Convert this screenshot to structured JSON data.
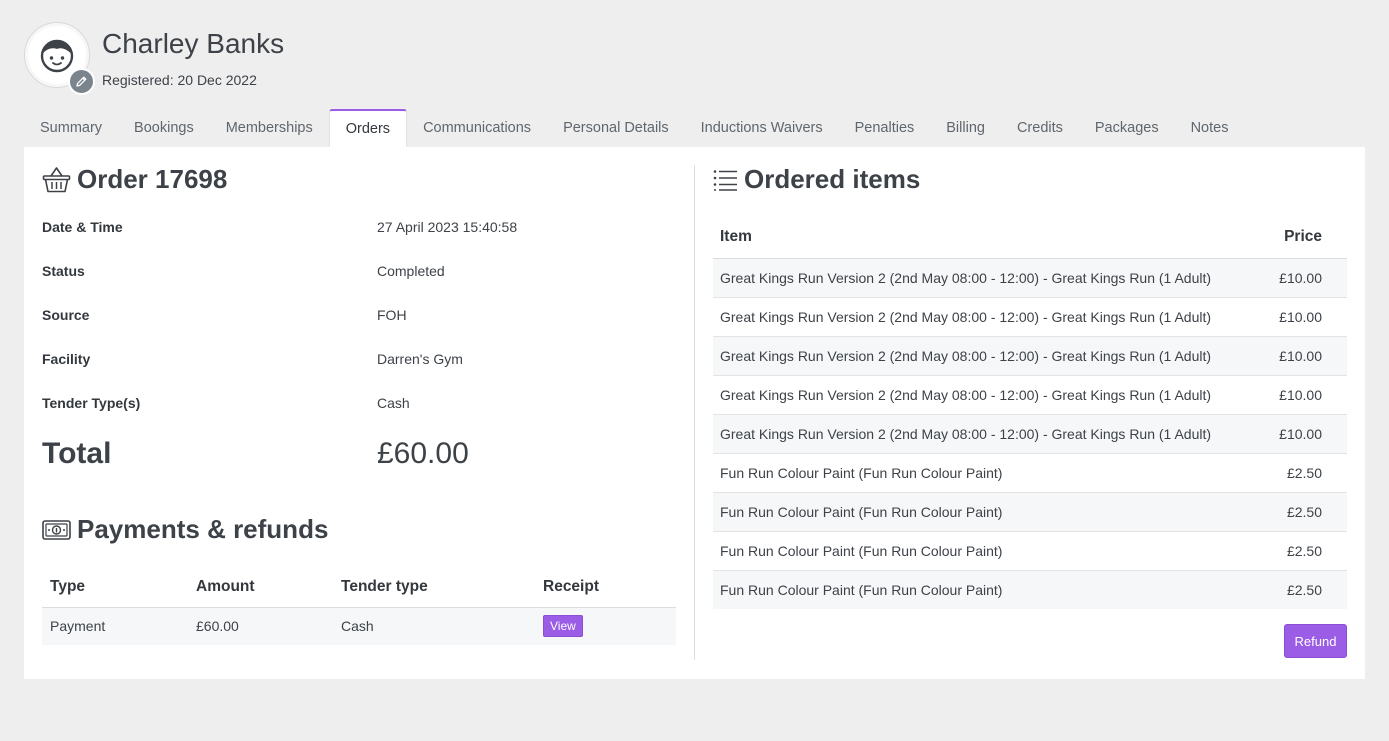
{
  "member": {
    "name": "Charley Banks",
    "registered": "Registered: 20 Dec 2022"
  },
  "tabs": [
    {
      "label": "Summary"
    },
    {
      "label": "Bookings"
    },
    {
      "label": "Memberships"
    },
    {
      "label": "Orders",
      "active": true
    },
    {
      "label": "Communications"
    },
    {
      "label": "Personal Details"
    },
    {
      "label": "Inductions Waivers"
    },
    {
      "label": "Penalties"
    },
    {
      "label": "Billing"
    },
    {
      "label": "Credits"
    },
    {
      "label": "Packages"
    },
    {
      "label": "Notes"
    }
  ],
  "order": {
    "title": "Order 17698",
    "icon": "basket-icon",
    "details": [
      {
        "label": "Date & Time",
        "value": "27 April 2023 15:40:58"
      },
      {
        "label": "Status",
        "value": "Completed"
      },
      {
        "label": "Source",
        "value": "FOH"
      },
      {
        "label": "Facility",
        "value": "Darren's Gym"
      },
      {
        "label": "Tender Type(s)",
        "value": "Cash"
      }
    ],
    "total_label": "Total",
    "total_value": "£60.00"
  },
  "payments": {
    "title": "Payments & refunds",
    "icon": "money-icon",
    "columns": [
      "Type",
      "Amount",
      "Tender type",
      "Receipt"
    ],
    "rows": [
      {
        "type": "Payment",
        "amount": "£60.00",
        "tender": "Cash",
        "receipt": "View"
      }
    ]
  },
  "items": {
    "title": "Ordered items",
    "icon": "list-icon",
    "columns": [
      "Item",
      "Price"
    ],
    "rows": [
      {
        "item": "Great Kings Run Version 2 (2nd May 08:00 - 12:00) - Great Kings Run (1 Adult)",
        "price": "£10.00"
      },
      {
        "item": "Great Kings Run Version 2 (2nd May 08:00 - 12:00) - Great Kings Run (1 Adult)",
        "price": "£10.00"
      },
      {
        "item": "Great Kings Run Version 2 (2nd May 08:00 - 12:00) - Great Kings Run (1 Adult)",
        "price": "£10.00"
      },
      {
        "item": "Great Kings Run Version 2 (2nd May 08:00 - 12:00) - Great Kings Run (1 Adult)",
        "price": "£10.00"
      },
      {
        "item": "Great Kings Run Version 2 (2nd May 08:00 - 12:00) - Great Kings Run (1 Adult)",
        "price": "£10.00"
      },
      {
        "item": "Fun Run Colour Paint (Fun Run Colour Paint)",
        "price": "£2.50"
      },
      {
        "item": "Fun Run Colour Paint (Fun Run Colour Paint)",
        "price": "£2.50"
      },
      {
        "item": "Fun Run Colour Paint (Fun Run Colour Paint)",
        "price": "£2.50"
      },
      {
        "item": "Fun Run Colour Paint (Fun Run Colour Paint)",
        "price": "£2.50"
      }
    ],
    "refund_label": "Refund"
  },
  "colors": {
    "accent": "#9b5de5",
    "background": "#eeeeee",
    "text": "#3d4248"
  }
}
